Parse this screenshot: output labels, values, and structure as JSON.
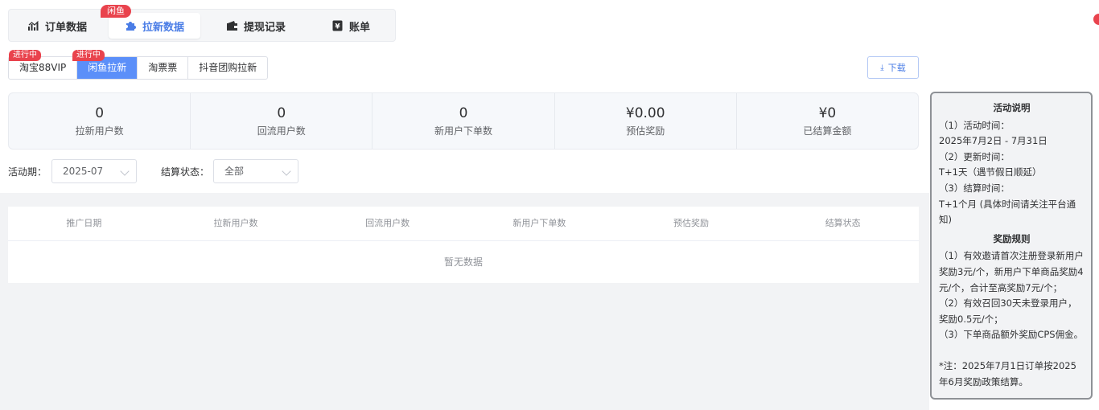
{
  "main_tabs": {
    "badge": "闲鱼",
    "items": [
      {
        "label": "订单数据",
        "icon": "chart-icon"
      },
      {
        "label": "拉新数据",
        "icon": "puzzle-icon"
      },
      {
        "label": "提现记录",
        "icon": "wallet-icon"
      },
      {
        "label": "账单",
        "icon": "bill-icon"
      }
    ],
    "active_index": 1
  },
  "sub_tabs": {
    "badge": "进行中",
    "items": [
      "淘宝88VIP",
      "闲鱼拉新",
      "淘票票",
      "抖音团购拉新"
    ],
    "active_index": 1
  },
  "download_label": "下载",
  "stats": [
    {
      "value": "0",
      "label": "拉新用户数"
    },
    {
      "value": "0",
      "label": "回流用户数"
    },
    {
      "value": "0",
      "label": "新用户下单数"
    },
    {
      "value": "¥0.00",
      "label": "预估奖励"
    },
    {
      "value": "¥0",
      "label": "已结算金额"
    }
  ],
  "filters": {
    "period_label": "活动期：",
    "period_value": "2025-07",
    "status_label": "结算状态：",
    "status_value": "全部"
  },
  "table": {
    "columns": [
      "推广日期",
      "拉新用户数",
      "回流用户数",
      "新用户下单数",
      "预估奖励",
      "结算状态"
    ],
    "empty_text": "暂无数据"
  },
  "side_panel": {
    "title1": "活动说明",
    "desc_lines": [
      "（1）活动时间：",
      "2025年7月2日 - 7月31日",
      "（2）更新时间：",
      "T+1天（遇节假日顺延）",
      "（3）结算时间：",
      "T+1个月 (具体时间请关注平台通知)"
    ],
    "title2": "奖励规则",
    "rule_lines": [
      "（1）有效邀请首次注册登录新用户奖励3元/个，新用户下单商品奖励4元/个，合计至高奖励7元/个；",
      "（2）有效召回30天未登录用户，奖励0.5元/个；",
      "（3）下单商品额外奖励CPS佣金。"
    ],
    "note": "*注：2025年7月1日订单按2025年6月奖励政策结算。"
  },
  "colors": {
    "accent": "#4a7de6",
    "active_tab": "#5b8ff9",
    "badge": "#e9434d"
  }
}
